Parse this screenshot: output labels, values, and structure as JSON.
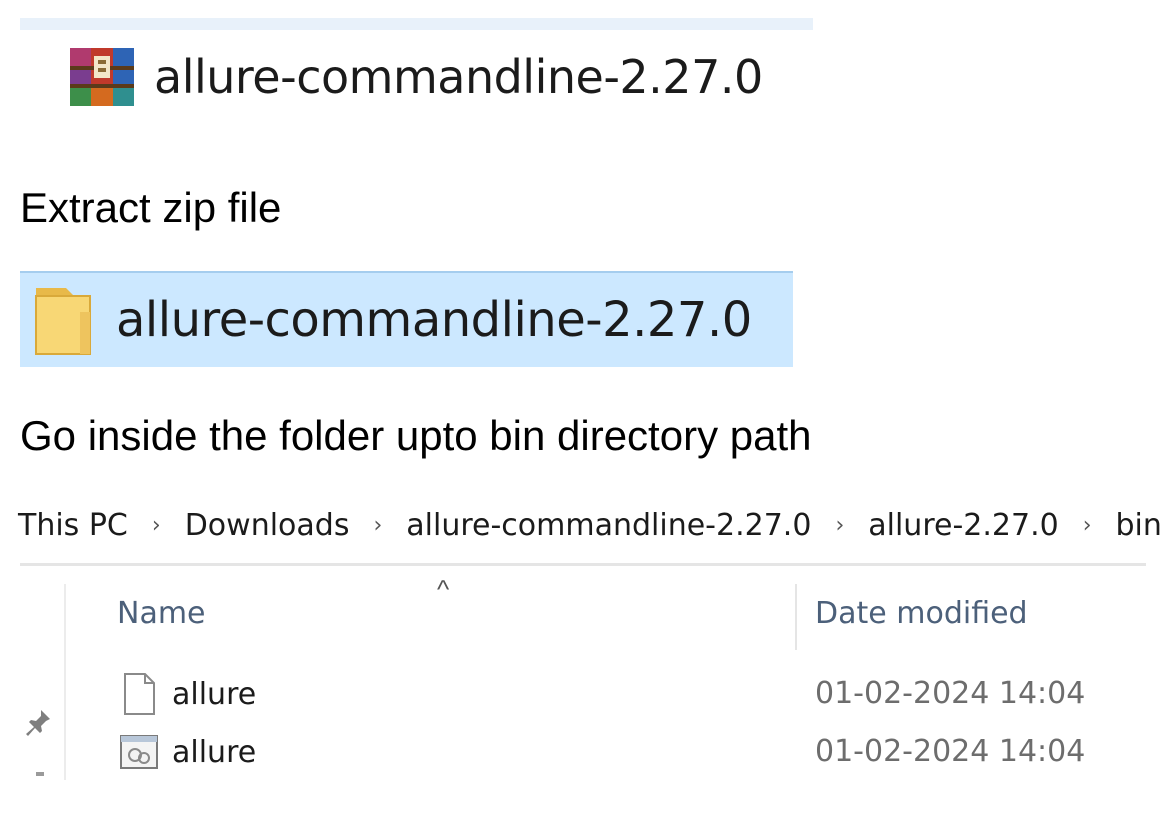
{
  "zip_file": {
    "name": "allure-commandline-2.27.0",
    "icon": "winrar-archive-icon"
  },
  "step1": {
    "text": "Extract zip file"
  },
  "extracted_folder": {
    "name": "allure-commandline-2.27.0",
    "icon": "folder-icon",
    "selected": true
  },
  "step2": {
    "text": "Go inside the folder upto bin directory path"
  },
  "breadcrumb": {
    "items": [
      "This PC",
      "Downloads",
      "allure-commandline-2.27.0",
      "allure-2.27.0",
      "bin"
    ],
    "separator": "›"
  },
  "file_list": {
    "sort_indicator": "^",
    "columns": [
      "Name",
      "Date modified"
    ],
    "rows": [
      {
        "name": "allure",
        "date_modified": "01-02-2024 14:04",
        "icon": "blank-file-icon"
      },
      {
        "name": "allure",
        "date_modified": "01-02-2024 14:04",
        "icon": "batch-file-icon"
      }
    ]
  },
  "colors": {
    "selection": "#cce8ff",
    "header_text": "#4c607a",
    "folder": "#f8d775"
  }
}
